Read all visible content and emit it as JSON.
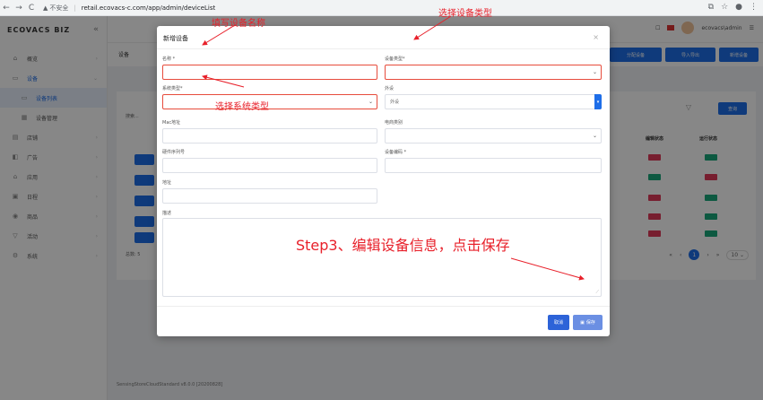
{
  "browser": {
    "back": "←",
    "forward": "→",
    "reload": "C",
    "insecure": "不安全",
    "url": "retail.ecovacs-c.com/app/admin/deviceList"
  },
  "app": {
    "logo": "ECOVACS BIZ",
    "user": "ecovacs\\admin",
    "sidebar": [
      {
        "label": "概览",
        "icon": "home-icon"
      },
      {
        "label": "设备",
        "icon": "device-icon"
      },
      {
        "label": "设备列表",
        "icon": "list-icon"
      },
      {
        "label": "设备管理",
        "icon": "grid-icon"
      },
      {
        "label": "店铺",
        "icon": "store-icon"
      },
      {
        "label": "广告",
        "icon": "ad-icon"
      },
      {
        "label": "应用",
        "icon": "app-icon"
      },
      {
        "label": "日程",
        "icon": "calendar-icon"
      },
      {
        "label": "商品",
        "icon": "goods-icon"
      },
      {
        "label": "活动",
        "icon": "event-icon"
      },
      {
        "label": "系统",
        "icon": "system-icon"
      }
    ],
    "breadcrumb": "设备",
    "toolbar": {
      "assign": "分配设备",
      "import_export": "导入导出",
      "add_device": "新增设备"
    },
    "search_placeholder": "搜索...",
    "search_button": "查询",
    "columns": {
      "edit_status": "编辑状态",
      "run_status": "运行状态"
    },
    "total": "总数: 5",
    "page_current": "1",
    "page_size": "10",
    "footer": "SensingStoreCloudStandard v8.0.0 [20200828]"
  },
  "modal": {
    "title": "新增设备",
    "name_label": "名称 *",
    "device_type_label": "设备类型*",
    "system_type_label": "系统类型*",
    "peripheral_label": "外设",
    "peripheral_value": "外设",
    "mac_label": "Mac地址",
    "category_label": "电商类别",
    "serial_label": "硬件序列号",
    "device_code_label": "设备编码 *",
    "address_label": "地址",
    "desc_label": "描述",
    "cancel": "取消",
    "save": "保存"
  },
  "annotations": {
    "fill_name": "填写设备名称",
    "choose_device_type": "选择设备类型",
    "choose_system_type": "选择系统类型",
    "step3": "Step3、编辑设备信息，点击保存"
  },
  "colors": {
    "annotation_red": "#e8202a",
    "primary_blue": "#1e6ee8",
    "error_red": "#e74c3c"
  }
}
